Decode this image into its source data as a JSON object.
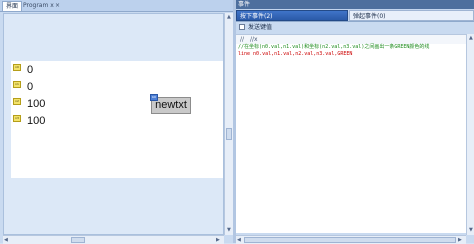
{
  "left_pane": {
    "tabs": [
      {
        "label": "界面",
        "active": true
      },
      {
        "label": "Program x",
        "active": false
      }
    ],
    "close_glyph": "×",
    "canvas": {
      "fields": [
        {
          "marker": "n0",
          "value": "0"
        },
        {
          "marker": "n1",
          "value": "0"
        },
        {
          "marker": "n2",
          "value": "100"
        },
        {
          "marker": "n3",
          "value": "100"
        }
      ],
      "button": {
        "marker": "b0",
        "label": "newtxt"
      }
    }
  },
  "right_pane": {
    "title": "事件",
    "subtabs": [
      {
        "label": "按下事件(2)",
        "active": true
      },
      {
        "label": "弹起事件(0)",
        "active": false
      }
    ],
    "options": {
      "checkbox_label": "发送键值",
      "checked": false
    },
    "editor_toolbar": {
      "comment_btn": "//",
      "uncomment_btn": "//x"
    },
    "code": [
      {
        "text": "//在坐标(n0.val,n1.val)和坐标(n2.val,n3.val)之间画出一条GREEN颜色的线",
        "kind": "comment"
      },
      {
        "text": "line n0.val,n1.val,n2.val,n3.val,GREEN",
        "kind": "statement"
      }
    ]
  },
  "colors": {
    "comment": "#1a8a1a",
    "statement": "#cc0000",
    "selected_tab": "#2b5aa8"
  }
}
